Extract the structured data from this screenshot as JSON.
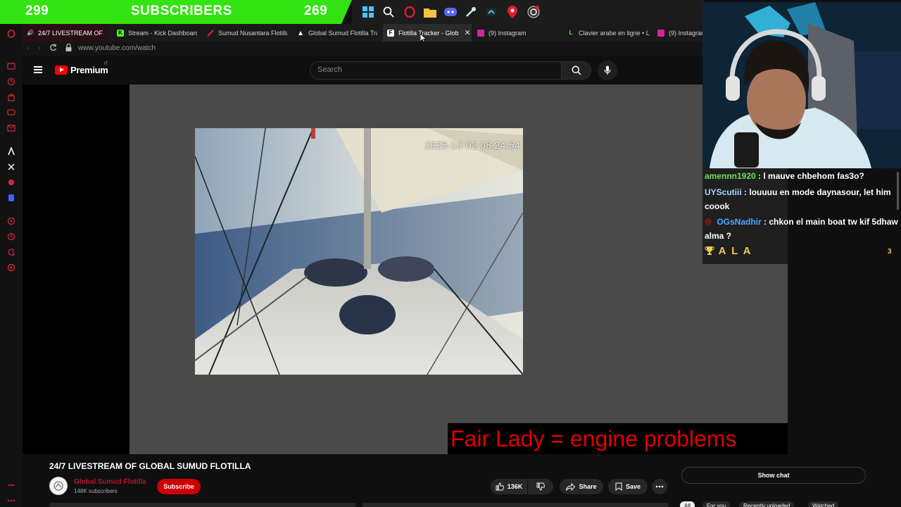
{
  "stream_overlay": {
    "subscriber_count_left": "299",
    "subscribers_label": "SUBSCRIBERS",
    "subscriber_count_right": "269"
  },
  "taskbar": {
    "icons": [
      "windows-start-icon",
      "search-icon",
      "opera-icon",
      "folder-icon",
      "discord-icon",
      "steam-icon",
      "app-icon",
      "maps-pin-icon",
      "obs-icon"
    ]
  },
  "browser": {
    "tabs": [
      {
        "label": "24/7 LIVESTREAM OF",
        "favicon": "youtube",
        "state": "playing"
      },
      {
        "label": "Stream - Kick Dashboard",
        "favicon": "kick"
      },
      {
        "label": "Sumud Nusantara Flotilla",
        "favicon": "sumud"
      },
      {
        "label": "Global Sumud Flotilla Tra",
        "favicon": "triangle"
      },
      {
        "label": "Flotilla Tracker - Glob",
        "favicon": "tracker",
        "state": "active"
      },
      {
        "label": "(9) Instagram",
        "favicon": "instagram"
      },
      {
        "label": "Clavier arabe en ligne • L",
        "favicon": "lexilogos"
      },
      {
        "label": "(9) Instagram",
        "favicon": "instagram"
      }
    ],
    "url": "www.youtube.com/watch"
  },
  "youtube": {
    "brand": "Premium",
    "brand_suffix": "IT",
    "search_placeholder": "Search",
    "video": {
      "timestamp_overlay": "2025-10-02 08:24:54",
      "caption": "Fair Lady = engine problems",
      "title": "24/7 LIVESTREAM OF GLOBAL SUMUD FLOTILLA"
    },
    "channel": {
      "name": "Global Sumud Flotilla",
      "subscribers": "148K subscribers",
      "subscribe_label": "Subscribe"
    },
    "actions": {
      "likes": "136K",
      "share_label": "Share",
      "save_label": "Save"
    },
    "show_chat_label": "Show chat",
    "chips": [
      "All",
      "For you",
      "Recently uploaded",
      "Watched"
    ]
  },
  "chat": {
    "messages": [
      {
        "user": "amennn1920",
        "text": ": l mauve chbehom fas3o?"
      },
      {
        "user": "UYScutiii",
        "text": ": louuuu en mode daynasour, let him coook"
      },
      {
        "user": "OGsNadhir",
        "text": ": chkon el main boat tw kif 5dhaw alma ?"
      }
    ],
    "leader_name": "A L A",
    "leader_count": "3"
  },
  "colors": {
    "subscriber_bar": "#34e312",
    "youtube_red": "#ff0000",
    "caption_red": "#e00000",
    "chat_gold": "#f2c94c"
  }
}
